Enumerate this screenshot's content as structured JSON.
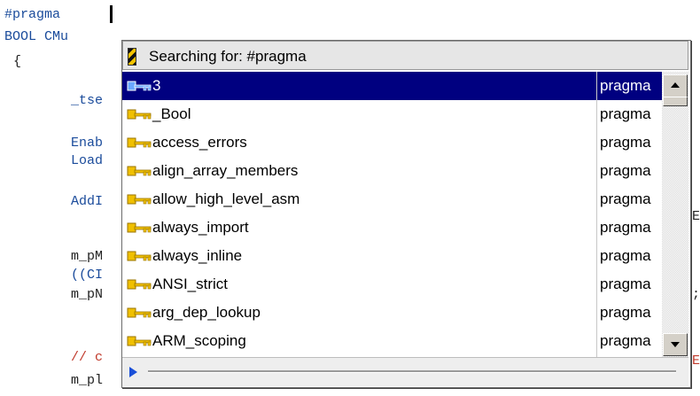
{
  "editor": {
    "line1": "#pragma",
    "line2": "BOOL CMu",
    "line3": "{",
    "line4": "_tse",
    "line5": "Enab",
    "line6": "Load",
    "line7": "AddI",
    "line8": "m_pM",
    "line9": "((CI",
    "line10": "m_pN",
    "line11": "// c",
    "line12": "m_pl",
    "frag_comma": ",",
    "frag_semicolon": ";",
    "frag_e": "E",
    "frag_e2": "E"
  },
  "popup": {
    "header_text": "Searching for: #pragma",
    "items": [
      {
        "name": "3",
        "kind": "pragma",
        "selected": true,
        "icon": "key-icon"
      },
      {
        "name": "_Bool",
        "kind": "pragma",
        "icon": "key-icon"
      },
      {
        "name": "access_errors",
        "kind": "pragma",
        "icon": "key-icon"
      },
      {
        "name": "align_array_members",
        "kind": "pragma",
        "icon": "key-icon"
      },
      {
        "name": "allow_high_level_asm",
        "kind": "pragma",
        "icon": "key-icon"
      },
      {
        "name": "always_import",
        "kind": "pragma",
        "icon": "key-icon"
      },
      {
        "name": "always_inline",
        "kind": "pragma",
        "icon": "key-icon"
      },
      {
        "name": "ANSI_strict",
        "kind": "pragma",
        "icon": "key-icon"
      },
      {
        "name": "arg_dep_lookup",
        "kind": "pragma",
        "icon": "key-icon"
      },
      {
        "name": "ARM_scoping",
        "kind": "pragma",
        "icon": "key-icon"
      }
    ]
  },
  "colors": {
    "selection": "#000080",
    "keyword": "#1a4b9b",
    "key_icon_gold": "#f0c000",
    "key_icon_blue": "#6aa8ff"
  }
}
